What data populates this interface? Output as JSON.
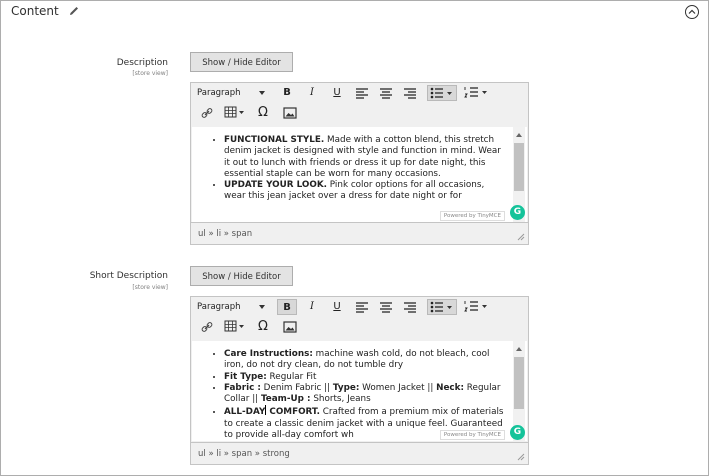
{
  "section": {
    "title": "Content"
  },
  "toolbar": {
    "format_label": "Paragraph",
    "toggle_label": "Show / Hide Editor",
    "bold": "B",
    "italic": "I",
    "underline": "U",
    "omega": "Ω"
  },
  "description": {
    "label": "Description",
    "scope": "[store view]",
    "items": [
      {
        "bold": "FUNCTIONAL STYLE.",
        "text": " Made with a cotton blend, this stretch denim jacket is designed with style and function in mind. Wear it out to lunch with friends or dress it up for date night, this essential staple can be worn for many occasions."
      },
      {
        "bold": "UPDATE YOUR LOOK.",
        "text": " Pink color options for all occasions, wear this jean jacket over a dress for date night or for"
      }
    ],
    "powered_by": "Powered by TinyMCE",
    "path": "ul » li » span"
  },
  "short_description": {
    "label": "Short Description",
    "scope": "[store view]",
    "items": [
      {
        "parts": [
          {
            "b": "Care Instructions:"
          },
          {
            "t": " machine wash cold, do not bleach, cool iron, do not dry clean, do not tumble dry"
          }
        ]
      },
      {
        "parts": [
          {
            "b": "Fit Type:"
          },
          {
            "t": " Regular Fit"
          }
        ]
      },
      {
        "parts": [
          {
            "b": "Fabric :"
          },
          {
            "t": " Denim Fabric || "
          },
          {
            "b": "Type:"
          },
          {
            "t": " Women Jacket || "
          },
          {
            "b": "Neck:"
          },
          {
            "t": " Regular Collar || "
          },
          {
            "b": "Team-Up :"
          },
          {
            "t": " Shorts, Jeans"
          }
        ]
      },
      {
        "parts": [
          {
            "b": "ALL-DAY"
          },
          {
            "cursor": true
          },
          {
            "b": " COMFORT."
          },
          {
            "t": " Crafted from a premium mix of materials to create a classic denim jacket with a unique feel. Guaranteed to provide all-day comfort wh"
          }
        ]
      }
    ],
    "powered_by": "Powered by TinyMCE",
    "path": "ul » li » span » strong"
  },
  "icons": {
    "edit": "pencil-icon",
    "collapse": "chevron-up-circle-icon",
    "link": "link-icon",
    "table": "table-icon",
    "special_char": "omega-icon",
    "image": "image-icon",
    "grammarly": "grammarly-icon"
  },
  "grammarly_glyph": "G"
}
